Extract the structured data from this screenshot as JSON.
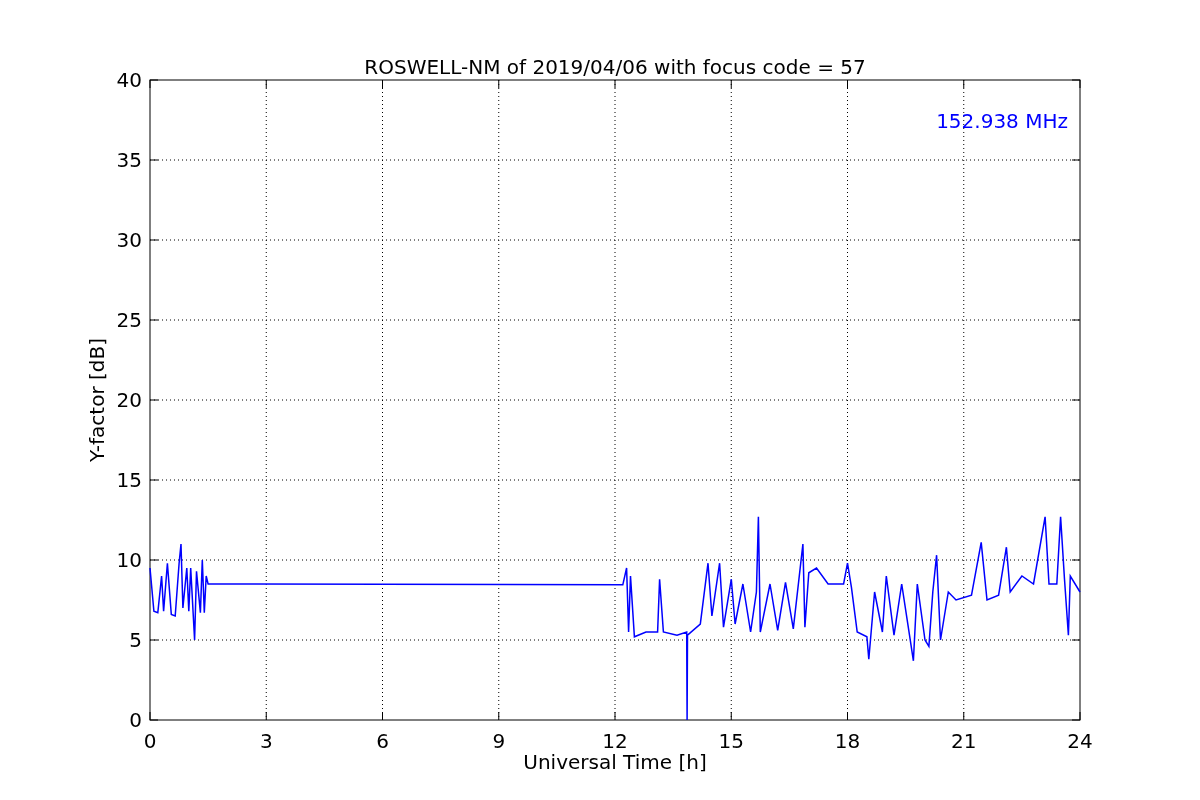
{
  "chart_data": {
    "type": "line",
    "title": "ROSWELL-NM of 2019/04/06 with focus code = 57",
    "xlabel": "Universal Time [h]",
    "ylabel": "Y-factor [dB]",
    "x": [
      0,
      0.1,
      0.2,
      0.3,
      0.35,
      0.45,
      0.55,
      0.65,
      0.75,
      0.8,
      0.85,
      0.95,
      1.0,
      1.05,
      1.15,
      1.2,
      1.3,
      1.35,
      1.4,
      1.45,
      1.5,
      12.2,
      12.3,
      12.35,
      12.4,
      12.5,
      12.8,
      13.1,
      13.15,
      13.25,
      13.6,
      13.85,
      13.86,
      13.87,
      14.2,
      14.4,
      14.5,
      14.7,
      14.8,
      15.0,
      15.1,
      15.3,
      15.5,
      15.65,
      15.7,
      15.75,
      16.0,
      16.2,
      16.4,
      16.6,
      16.85,
      16.9,
      17.0,
      17.2,
      17.5,
      17.9,
      18.0,
      18.1,
      18.25,
      18.5,
      18.55,
      18.7,
      18.9,
      19.0,
      19.2,
      19.4,
      19.6,
      19.7,
      19.8,
      20.0,
      20.1,
      20.2,
      20.3,
      20.4,
      20.6,
      20.8,
      21.2,
      21.45,
      21.6,
      21.9,
      22.1,
      22.2,
      22.5,
      22.8,
      23.1,
      23.2,
      23.4,
      23.5,
      23.6,
      23.7,
      23.75,
      24.0
    ],
    "series": [
      {
        "name": "152.938 MHz",
        "color": "#0000ff",
        "values": [
          9.5,
          6.8,
          6.7,
          9.0,
          6.8,
          9.8,
          6.6,
          6.5,
          9.8,
          11.0,
          7.0,
          9.5,
          6.8,
          9.5,
          5.0,
          9.3,
          6.7,
          10.0,
          6.7,
          9.0,
          8.5,
          8.45,
          9.5,
          5.5,
          9.0,
          5.2,
          5.5,
          5.5,
          8.8,
          5.5,
          5.3,
          5.5,
          0,
          5.3,
          6.0,
          9.8,
          6.5,
          9.8,
          5.8,
          8.8,
          6.0,
          8.5,
          5.5,
          8.0,
          12.7,
          5.5,
          8.5,
          5.6,
          8.6,
          5.7,
          11.0,
          5.8,
          9.2,
          9.5,
          8.5,
          8.5,
          9.8,
          8.3,
          5.5,
          5.2,
          3.8,
          8.0,
          5.5,
          9.0,
          5.3,
          8.5,
          5.3,
          3.7,
          8.5,
          5.0,
          4.6,
          8.0,
          10.3,
          5.0,
          8.0,
          7.5,
          7.8,
          11.1,
          7.5,
          7.8,
          10.8,
          8.0,
          9.0,
          8.5,
          12.7,
          8.5,
          8.5,
          12.7,
          8.8,
          5.3,
          9.0,
          8.0
        ]
      }
    ],
    "xlim": [
      0,
      24
    ],
    "ylim": [
      0,
      40
    ],
    "xticks": [
      0,
      3,
      6,
      9,
      12,
      15,
      18,
      21,
      24
    ],
    "yticks": [
      0,
      5,
      10,
      15,
      20,
      25,
      30,
      35,
      40
    ],
    "grid": true
  }
}
